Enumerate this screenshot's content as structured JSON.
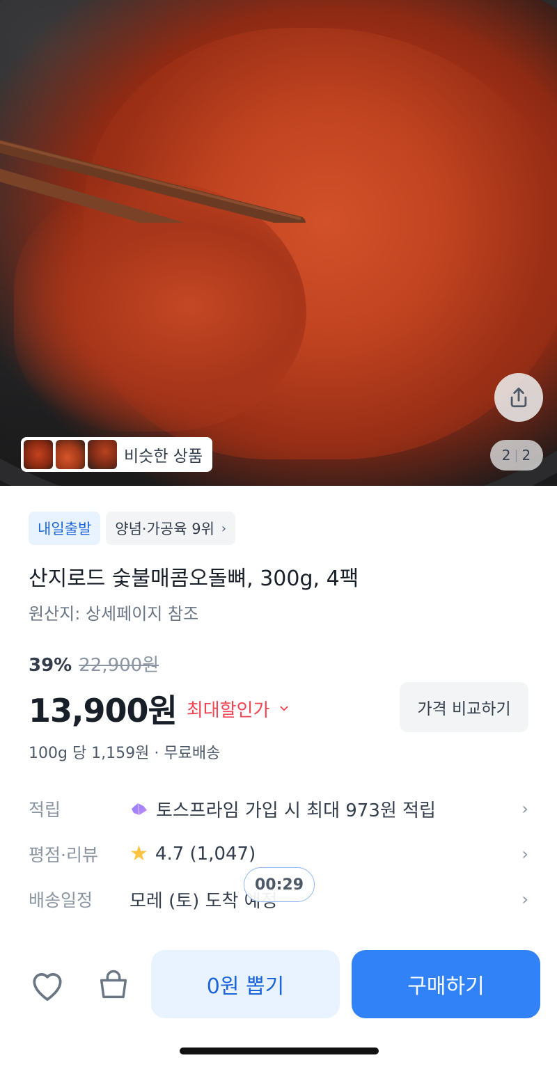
{
  "hero": {
    "image_counter_current": "2",
    "image_counter_total": "2",
    "similar_label": "비슷한 상품"
  },
  "tags": {
    "delivery_badge": "내일출발",
    "category_rank": "양념·가공육 9위"
  },
  "product": {
    "title": "산지로드 숯불매콤오돌뼈, 300g, 4팩",
    "origin": "원산지: 상세페이지 참조"
  },
  "pricing": {
    "discount_rate": "39%",
    "original_price": "22,900원",
    "price": "13,900원",
    "max_discount_label": "최대할인가",
    "compare_button": "가격 비교하기",
    "unit_line": "100g 당 1,159원 · 무료배송"
  },
  "info": {
    "points_label": "적립",
    "points_value": "토스프라임 가입 시 최대 973원 적립",
    "review_label": "평점·리뷰",
    "review_value": "4.7 (1,047)",
    "delivery_label": "배송일정",
    "delivery_value": "모레 (토) 도착 예정"
  },
  "timer": "00:29",
  "bottom_bar": {
    "coupon_button": "0원 뽑기",
    "buy_button": "구매하기"
  },
  "colors": {
    "primary_blue": "#3182f6",
    "light_blue": "#e8f3ff",
    "discount_red": "#f04452",
    "star_yellow": "#ffc342"
  }
}
